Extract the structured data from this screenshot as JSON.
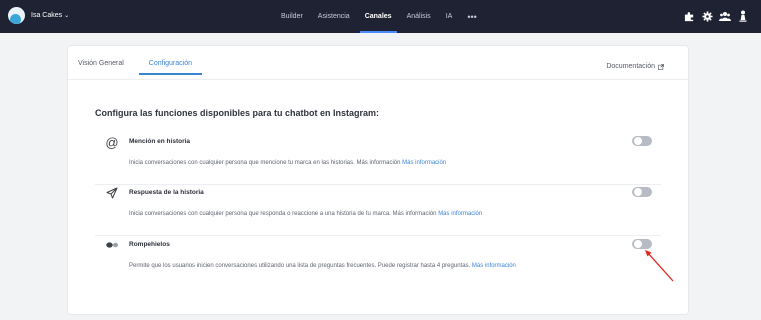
{
  "header": {
    "brand_name": "Isa Cakes",
    "nav": [
      "Builder",
      "Asistencia",
      "Canales",
      "Análisis",
      "IA"
    ],
    "active_nav": "Canales",
    "more": "•••",
    "right_icons": [
      "puzzle-icon",
      "gear-icon",
      "users-icon",
      "user-icon"
    ]
  },
  "tabs": {
    "overview": "Visión General",
    "config": "Configuración"
  },
  "docs_link": "Documentación",
  "section_title": "Configura las funciones disponibles para tu chatbot en Instagram:",
  "features": [
    {
      "icon": "at-icon",
      "title": "Mención en historia",
      "description": "Inicia conversaciones con cualquier persona que mencione tu marca en las historias. Más información",
      "link": "Más información",
      "enabled": false
    },
    {
      "icon": "send-icon",
      "title": "Respuesta de la historia",
      "description": "Inicia conversaciones con cualquier persona que responda o reaccione a una historia de tu marca. Más información",
      "link": "Más información",
      "enabled": false
    },
    {
      "icon": "chat-dots-icon",
      "title": "Rompehielos",
      "description": "Permite que los usuarios inicien conversaciones utilizando una lista de preguntas frecuentes. Puede registrar hasta 4 preguntas.",
      "link": "Más información",
      "enabled": false
    }
  ],
  "colors": {
    "topbar": "#1f2233",
    "accent": "#3a84d8",
    "toggle_off": "#b7bcc4",
    "arrow": "#e0251b"
  }
}
